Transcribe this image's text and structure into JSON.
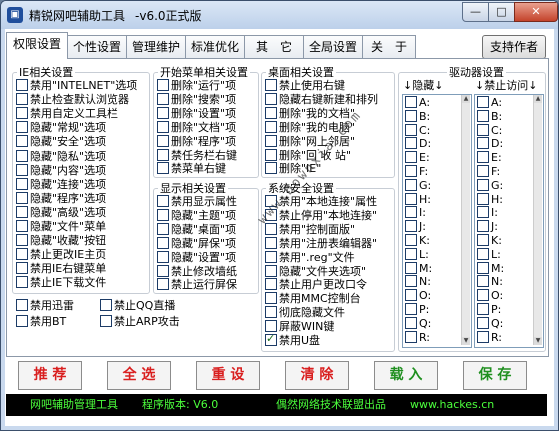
{
  "window": {
    "title": "精锐网吧辅助工具",
    "version": "-v6.0正式版",
    "controls": {
      "minimize": "—",
      "maximize": "□",
      "close": "✕"
    }
  },
  "tabs": [
    "权限设置",
    "个性设置",
    "管理维护",
    "标准优化",
    "其　它",
    "全局设置",
    "关　于"
  ],
  "support_button": "支持作者",
  "ie_group": {
    "legend": "IE相关设置",
    "items": [
      "禁用\"INTELNET\"选项",
      "禁止检查默认浏览器",
      "禁用自定义工具栏",
      "隐藏\"常规\"选项",
      "隐藏\"安全\"选项",
      "隐藏\"隐私\"选项",
      "隐藏\"内容\"选项",
      "隐藏\"连接\"选项",
      "隐藏\"程序\"选项",
      "隐藏\"高级\"选项",
      "隐藏\"文件\"菜单",
      "隐藏\"收藏\"按钮",
      "禁止更改IE主页",
      "禁用IE右键菜单",
      "禁止IE下载文件"
    ]
  },
  "extra_items": [
    "禁用迅雷",
    "禁止QQ直播",
    "禁用BT",
    "禁止ARP攻击"
  ],
  "start_group": {
    "legend": "开始菜单相关设置",
    "items": [
      "删除\"运行\"项",
      "删除\"搜索\"项",
      "删除\"设置\"项",
      "删除\"文档\"项",
      "删除\"程序\"项",
      "禁任务栏右键",
      "禁菜单右键"
    ]
  },
  "display_group": {
    "legend": "显示相关设置",
    "items": [
      "禁用显示属性",
      "隐藏\"主题\"项",
      "隐藏\"桌面\"项",
      "隐藏\"屏保\"项",
      "隐藏\"设置\"项",
      "禁止修改墙纸",
      "禁止运行屏保"
    ]
  },
  "desktop_group": {
    "legend": "桌面相关设置",
    "items": [
      "禁止使用右键",
      "隐藏右键新建和排列",
      "删除\"我的文档\"",
      "删除\"我的电脑\"",
      "删除\"网上邻居\"",
      "删除\"回 收 站\"",
      "删除\"IE\""
    ]
  },
  "security_group": {
    "legend": "系统安全设置",
    "items": [
      {
        "label": "禁用\"本地连接\"属性",
        "checked": false
      },
      {
        "label": "禁止停用\"本地连接\"",
        "checked": false
      },
      {
        "label": "禁用\"控制面版\"",
        "checked": false
      },
      {
        "label": "禁用\"注册表编辑器\"",
        "checked": false
      },
      {
        "label": "禁用\".reg\"文件",
        "checked": false
      },
      {
        "label": "隐藏\"文件夹选项\"",
        "checked": false
      },
      {
        "label": "禁止用户更改口令",
        "checked": false
      },
      {
        "label": "禁用MMC控制台",
        "checked": false
      },
      {
        "label": "彻底隐藏文件",
        "checked": false
      },
      {
        "label": "屏蔽WIN键",
        "checked": false
      },
      {
        "label": "禁用U盘",
        "checked": true
      }
    ]
  },
  "drive_group": {
    "legend": "驱动器设置",
    "hide_header": "↓隐藏↓",
    "block_header": "↓禁止访问↓",
    "hide_drives": [
      "A:",
      "B:",
      "C:",
      "D:",
      "E:",
      "F:",
      "G:",
      "H:",
      "I:",
      "J:",
      "K:",
      "L:",
      "M:",
      "N:",
      "O:",
      "P:",
      "Q:",
      "R:"
    ],
    "block_drives": [
      "A:",
      "B:",
      "C:",
      "D:",
      "E:",
      "F:",
      "G:",
      "H:",
      "I:",
      "J:",
      "K:",
      "L:",
      "M:",
      "N:",
      "O:",
      "P:",
      "Q:",
      "R:"
    ]
  },
  "watermark": "www.Downxia.com",
  "actions": [
    "推 荐",
    "全 选",
    "重 设",
    "清 除",
    "载 入",
    "保 存"
  ],
  "status": {
    "app": "网吧辅助管理工具",
    "version": "程序版本: V6.0",
    "publisher": "偶然网络技术联盟出品",
    "url": "www.hackes.cn"
  },
  "colors": {
    "action_red": "#d91f1f",
    "action_green": "#1f8f1f",
    "status_text": "#4cff3c",
    "status_bg": "#000000"
  }
}
